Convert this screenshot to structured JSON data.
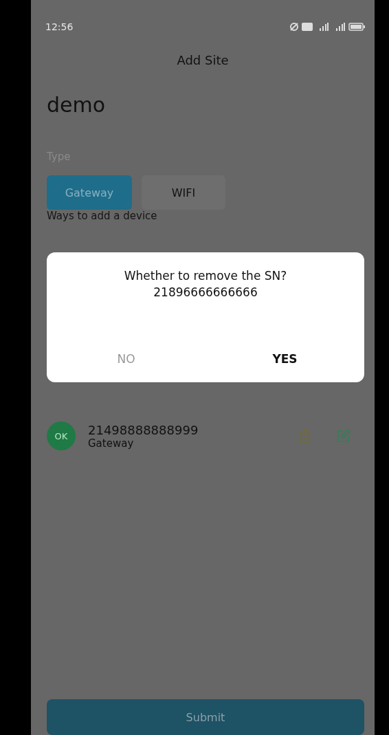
{
  "status_bar": {
    "time": "12:56"
  },
  "title": "Add Site",
  "site_name": "demo",
  "type_label": "Type",
  "type_tabs": [
    {
      "label": "Gateway",
      "selected": true
    },
    {
      "label": "WIFI",
      "selected": false
    }
  ],
  "ways_label": "Ways to add a device",
  "devices": [
    {
      "badge": "OK",
      "color": "#1f7a45",
      "sn": "21498888888999",
      "type": "Gateway"
    }
  ],
  "dialog": {
    "message": "Whether to remove the SN?",
    "sn": "21896666666666",
    "buttons": [
      {
        "label": "NO",
        "kind": "cancel"
      },
      {
        "label": "YES",
        "kind": "confirm"
      }
    ]
  },
  "submit": "Submit"
}
